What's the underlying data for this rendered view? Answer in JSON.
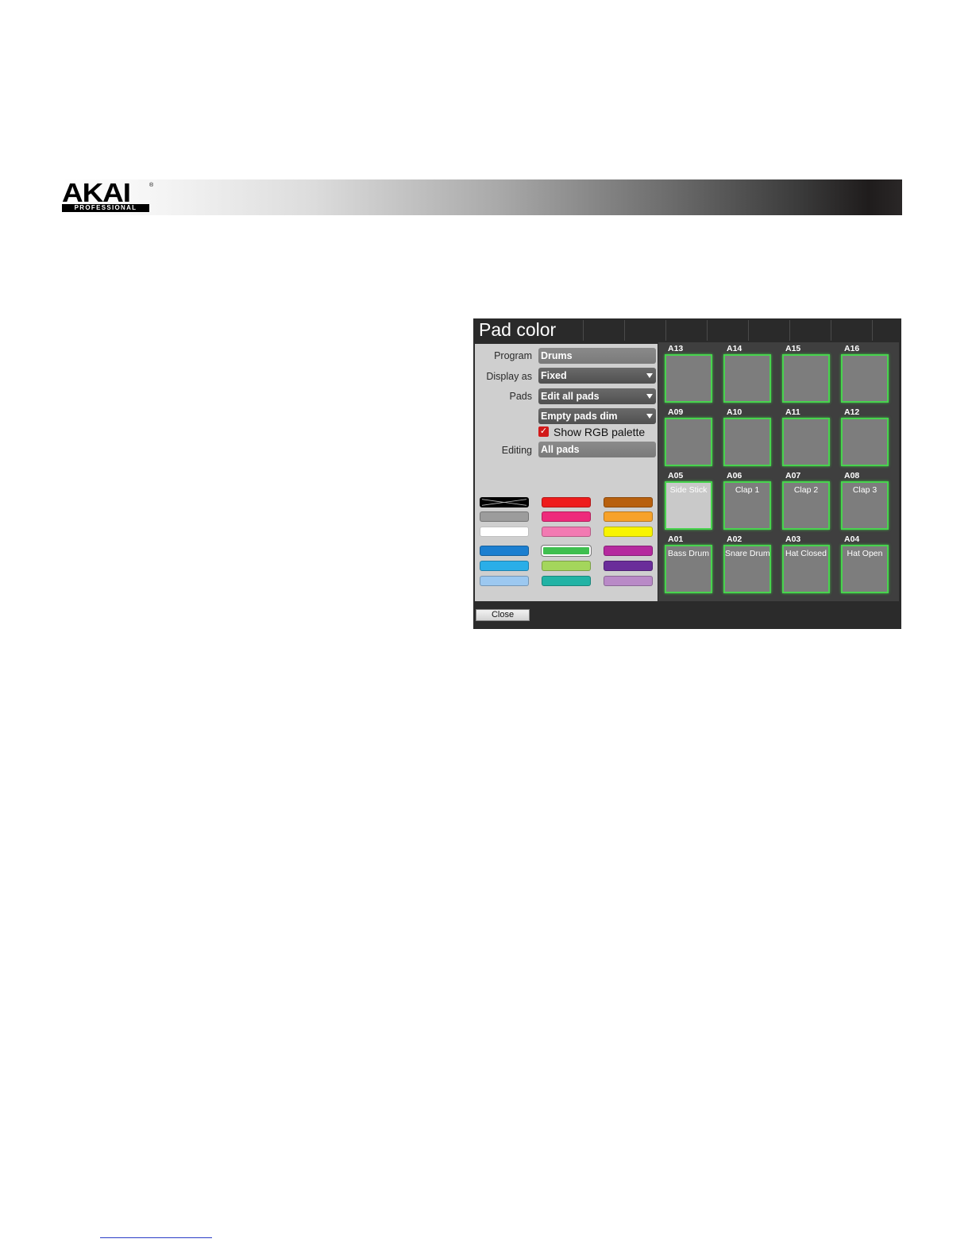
{
  "brand": {
    "logo_word": "AKAI",
    "logo_reg": "®",
    "logo_sub": "PROFESSIONAL"
  },
  "dialog": {
    "title": "Pad color",
    "fields": {
      "program_label": "Program",
      "program_value": "Drums",
      "display_label": "Display as",
      "display_value": "Fixed",
      "pads_label": "Pads",
      "pads_value": "Edit all pads",
      "empty_value": "Empty pads dim",
      "rgb_label": "Show RGB palette",
      "rgb_checked": true,
      "editing_label": "Editing",
      "editing_value": "All pads"
    },
    "palette": [
      {
        "color": "#000000",
        "name": "none"
      },
      {
        "color": "#ee1c1c"
      },
      {
        "color": "#b8600e"
      },
      {
        "color": "#9c9c9c"
      },
      {
        "color": "#ee2a7b"
      },
      {
        "color": "#f7a22a"
      },
      {
        "color": "#ffffff"
      },
      {
        "color": "#f27ab2"
      },
      {
        "color": "#f8f400"
      },
      {
        "color": "#1c7fd0"
      },
      {
        "color": "#3fbf4f",
        "selected": true
      },
      {
        "color": "#b52a9e"
      },
      {
        "color": "#2aaee8"
      },
      {
        "color": "#a4d65c"
      },
      {
        "color": "#6a2d9a"
      },
      {
        "color": "#9cc8f0"
      },
      {
        "color": "#22b3a5"
      },
      {
        "color": "#b98ac7"
      }
    ],
    "close_label": "Close",
    "pads": [
      {
        "id": "A13",
        "name": ""
      },
      {
        "id": "A14",
        "name": ""
      },
      {
        "id": "A15",
        "name": ""
      },
      {
        "id": "A16",
        "name": ""
      },
      {
        "id": "A09",
        "name": ""
      },
      {
        "id": "A10",
        "name": ""
      },
      {
        "id": "A11",
        "name": ""
      },
      {
        "id": "A12",
        "name": ""
      },
      {
        "id": "A05",
        "name": "Side Stick"
      },
      {
        "id": "A06",
        "name": "Clap 1"
      },
      {
        "id": "A07",
        "name": "Clap 2"
      },
      {
        "id": "A08",
        "name": "Clap 3"
      },
      {
        "id": "A01",
        "name": "Bass Drum"
      },
      {
        "id": "A02",
        "name": "Snare Drum"
      },
      {
        "id": "A03",
        "name": "Hat Closed"
      },
      {
        "id": "A04",
        "name": "Hat Open"
      }
    ],
    "pad_border_color": "#48d34e"
  }
}
